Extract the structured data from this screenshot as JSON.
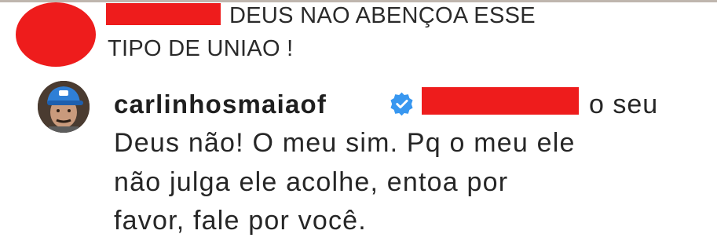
{
  "colors": {
    "redaction": "#ee1c1c",
    "verified_badge": "#3897f0",
    "text": "#262626"
  },
  "comment": {
    "text_line1": "DEUS NAO ABENÇOA ESSE",
    "text_line2": "TIPO DE UNIAO !"
  },
  "reply": {
    "username": "carlinhosmaiaof",
    "verified_icon": "verified-check-icon",
    "text_tail": "o seu",
    "text_line2": "Deus não! O meu sim. Pq o meu ele",
    "text_line3": "não julga ele acolhe, entoa por",
    "text_line4": "favor, fale por você."
  }
}
